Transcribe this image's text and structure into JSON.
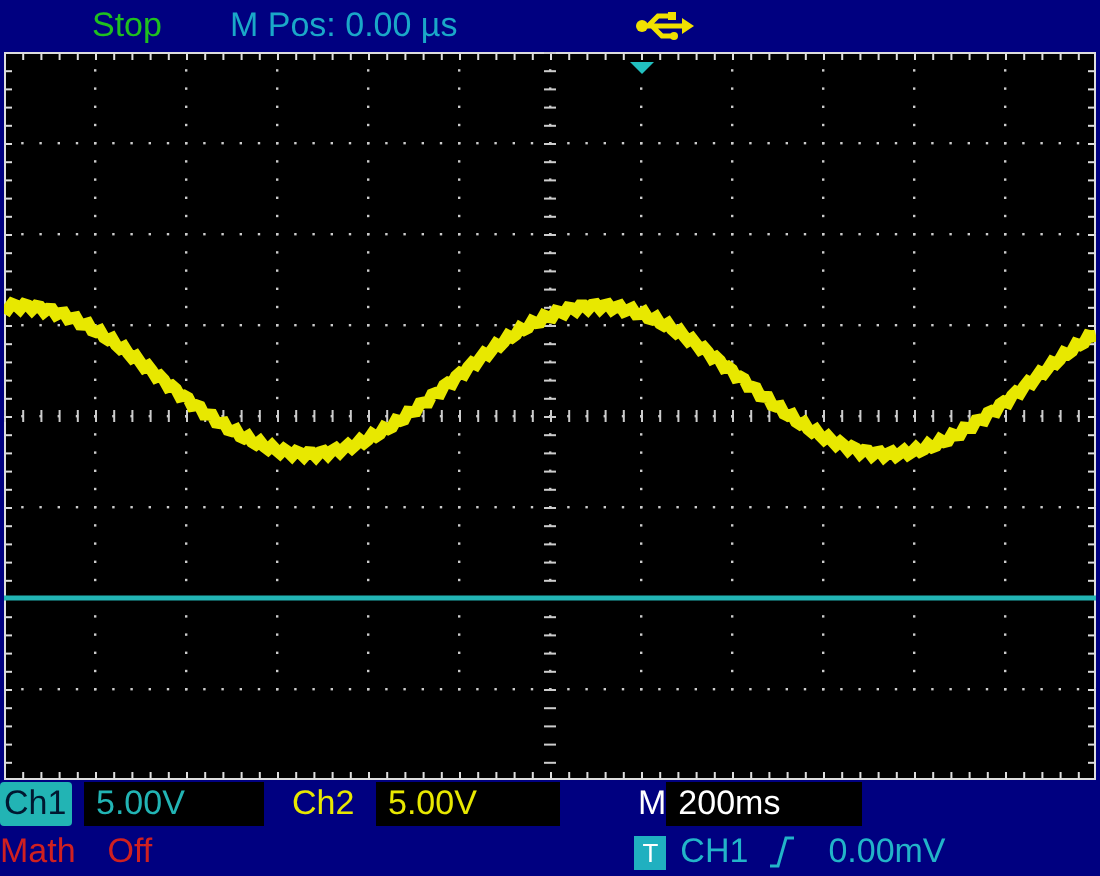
{
  "top_bar": {
    "status": "Stop",
    "m_pos": "M Pos: 0.00 µs"
  },
  "channels": [
    {
      "label": "Ch1",
      "scale": "5.00V",
      "selected": true,
      "color": "#22b4b4"
    },
    {
      "label": "Ch2",
      "scale": "5.00V",
      "selected": false,
      "color": "#e8e800"
    }
  ],
  "timebase": {
    "label": "M",
    "value": "200ms"
  },
  "math": {
    "label": "Math",
    "state": "Off"
  },
  "trigger": {
    "badge": "T",
    "source": "CH1",
    "level": "0.00mV"
  }
}
